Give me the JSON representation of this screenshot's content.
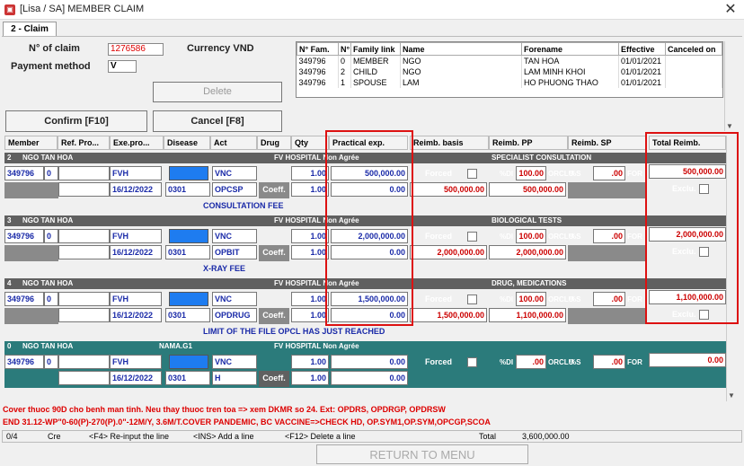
{
  "window": {
    "title": "[Lisa / SA] MEMBER CLAIM",
    "tab": "2 - Claim"
  },
  "claim": {
    "n_of_claim_label": "N° of claim",
    "n_of_claim_value": "1276586",
    "currency_label": "Currency VND",
    "payment_method_label": "Payment method",
    "payment_method_value": "V"
  },
  "buttons": {
    "delete": "Delete",
    "confirm": "Confirm [F10]",
    "cancel": "Cancel [F8]",
    "return": "RETURN TO MENU"
  },
  "family": {
    "headers": [
      "N° Fam.",
      "N°",
      "Family link",
      "Name",
      "Forename",
      "Effective",
      "Canceled on"
    ],
    "rows": [
      [
        "349796",
        "0",
        "MEMBER",
        "NGO",
        "TAN HOA",
        "01/01/2021",
        ""
      ],
      [
        "349796",
        "2",
        "CHILD",
        "NGO",
        "LAM MINH KHOI",
        "01/01/2021",
        ""
      ],
      [
        "349796",
        "1",
        "SPOUSE",
        "LAM",
        "HO PHUONG THAO",
        "01/01/2021",
        ""
      ]
    ]
  },
  "grid_headers": {
    "member": "Member",
    "ref": "Ref. Pro...",
    "exe": "Exe.pro...",
    "disease": "Disease",
    "act": "Act",
    "drug": "Drug",
    "qty": "Qty",
    "practical": "Practical exp.",
    "basis": "Reimb. basis",
    "pp": "Reimb. PP",
    "sp": "Reimb. SP",
    "total": "Total Reimb."
  },
  "common": {
    "coeff": "Coeff.",
    "forced": "Forced",
    "exclu": "Exclu.",
    "pct_di": "%DI",
    "orclu": "ORCLU",
    "for": "FOR",
    "so": "%S"
  },
  "lines": [
    {
      "num": "2",
      "name": "NGO TAN HOA",
      "group": "",
      "hospital": "FV HOSPITAL Non Agrée",
      "member": "349796",
      "ref": "0",
      "exe": "FVH",
      "date": "16/12/2022",
      "disease": "0301",
      "act": "VNC",
      "act_code": "OPCSP",
      "qty": "1.00",
      "coeff_val": "1.00",
      "practical": "500,000.00",
      "practical2": "0.00",
      "basis": "500,000.00",
      "category": "SPECIALIST CONSULTATION",
      "pct": "100.00",
      "sp_val": ".00",
      "pp": "500,000.00",
      "total": "500,000.00",
      "desc": "CONSULTATION FEE"
    },
    {
      "num": "3",
      "name": "NGO TAN HOA",
      "group": "",
      "hospital": "FV HOSPITAL Non Agrée",
      "member": "349796",
      "ref": "0",
      "exe": "FVH",
      "date": "16/12/2022",
      "disease": "0301",
      "act": "VNC",
      "act_code": "OPBIT",
      "qty": "1.00",
      "coeff_val": "1.00",
      "practical": "2,000,000.00",
      "practical2": "0.00",
      "basis": "2,000,000.00",
      "category": "BIOLOGICAL TESTS",
      "pct": "100.00",
      "sp_val": ".00",
      "pp": "2,000,000.00",
      "total": "2,000,000.00",
      "desc": "X-RAY FEE"
    },
    {
      "num": "4",
      "name": "NGO TAN HOA",
      "group": "",
      "hospital": "FV HOSPITAL Non Agrée",
      "member": "349796",
      "ref": "0",
      "exe": "FVH",
      "date": "16/12/2022",
      "disease": "0301",
      "act": "VNC",
      "act_code": "OPDRUG",
      "qty": "1.00",
      "coeff_val": "1.00",
      "practical": "1,500,000.00",
      "practical2": "0.00",
      "basis": "1,500,000.00",
      "category": "DRUG, MEDICATIONS",
      "pct": "100.00",
      "sp_val": ".00",
      "pp": "1,100,000.00",
      "total": "1,100,000.00",
      "desc": "LIMIT OF THE FILE OPCL HAS JUST REACHED"
    },
    {
      "num": "0",
      "name": "NGO TAN HOA",
      "group": "NAMA.G1",
      "hospital": "FV HOSPITAL Non Agrée",
      "member": "349796",
      "ref": "0",
      "exe": "FVH",
      "date": "16/12/2022",
      "disease": "0301",
      "act": "VNC",
      "act_code": "H",
      "qty": "1.00",
      "coeff_val": "1.00",
      "practical": "0.00",
      "practical2": "0.00",
      "basis": "",
      "category": "",
      "pct": ".00",
      "sp_val": ".00",
      "pp": "",
      "total": "0.00",
      "desc": ""
    }
  ],
  "messages": [
    "Cover thuoc 90D cho benh man tinh. Neu thay thuoc tren toa => xem DKMR so 24. Ext: OPDRS, OPDRGP, OPDRSW",
    "END 31.12-WP\"0-60(P)-270(P).0\"-12M/Y, 3.6M/T.COVER PANDEMIC, BC VACCINE=>CHECK HD, OP.SYM1,OP.SYM,OPCGP,SCOA"
  ],
  "status": {
    "position": "0/4",
    "mode": "Cre",
    "f4": "<F4> Re-input the line",
    "ins": "<INS> Add a line",
    "f12": "<F12> Delete a line",
    "total_label": "Total",
    "total_value": "3,600,000.00"
  },
  "colors": {
    "highlight_box": "#dd1111",
    "band_dark": "#606060",
    "band_teal": "#2b7b7b",
    "disease_blue": "#1e7cf0"
  }
}
